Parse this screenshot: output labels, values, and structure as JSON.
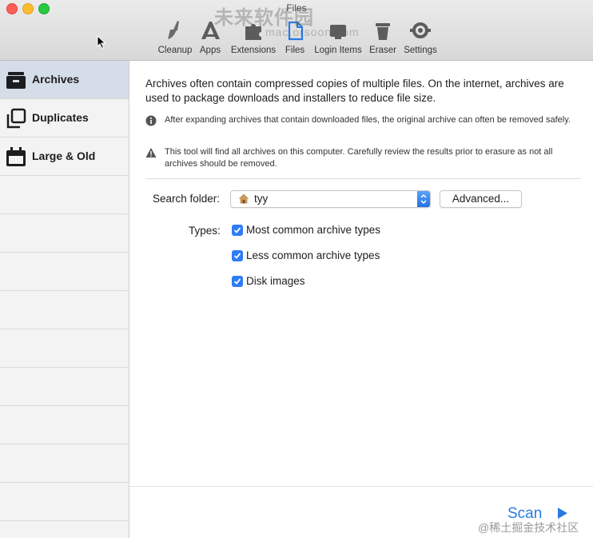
{
  "window": {
    "title": "Files"
  },
  "toolbar": {
    "items": [
      {
        "label": "Cleanup",
        "icon": "broom-icon"
      },
      {
        "label": "Apps",
        "icon": "apps-icon"
      },
      {
        "label": "Extensions",
        "icon": "extensions-icon"
      },
      {
        "label": "Files",
        "icon": "files-icon"
      },
      {
        "label": "Login Items",
        "icon": "login-items-icon"
      },
      {
        "label": "Eraser",
        "icon": "trash-icon"
      },
      {
        "label": "Settings",
        "icon": "gear-icon"
      }
    ],
    "active": "Files"
  },
  "watermark": {
    "main": "未来软件园",
    "sub": "mac.orsoon.com"
  },
  "sidebar": {
    "items": [
      {
        "label": "Archives",
        "icon": "archive-box-icon",
        "selected": true
      },
      {
        "label": "Duplicates",
        "icon": "duplicates-icon",
        "selected": false
      },
      {
        "label": "Large & Old",
        "icon": "calendar-icon",
        "selected": false
      }
    ]
  },
  "main": {
    "intro": "Archives often contain compressed copies of multiple files. On the internet, archives are used to package downloads and installers to reduce file size.",
    "notes": [
      {
        "icon": "info-icon",
        "text": "After expanding archives that contain downloaded files, the original archive can often be removed safely."
      },
      {
        "icon": "warning-icon",
        "text": "This tool will find all archives on this computer. Carefully review the results prior to erasure as not all archives should be removed."
      }
    ],
    "search_label": "Search folder:",
    "search_value": "tyy",
    "advanced_label": "Advanced...",
    "types_label": "Types:",
    "types": [
      {
        "label": "Most common archive types",
        "checked": true
      },
      {
        "label": "Less common archive types",
        "checked": true
      },
      {
        "label": "Disk images",
        "checked": true
      }
    ],
    "scan_label": "Scan"
  },
  "credit": "@稀土掘金技术社区",
  "colors": {
    "accent": "#2e7cf6",
    "scan": "#2a7ae2",
    "sidebar_selected": "#d5dde8"
  }
}
